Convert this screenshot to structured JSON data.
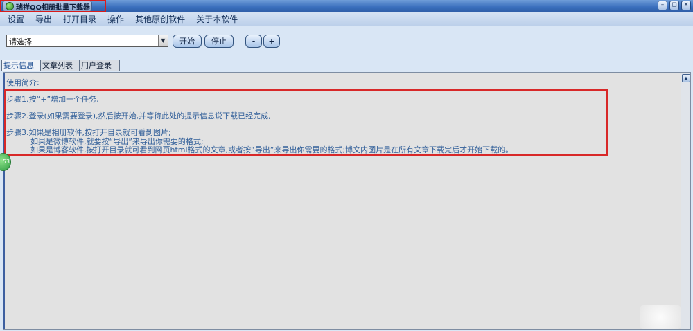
{
  "window": {
    "title": "瑞祥QQ相册批量下载器",
    "icons": [
      "app-icon",
      "minimize-icon",
      "restore-icon",
      "close-icon"
    ]
  },
  "menu": {
    "items": [
      "设置",
      "导出",
      "打开目录",
      "操作",
      "其他原创软件",
      "关于本软件"
    ]
  },
  "toolbar": {
    "select_value": "请选择",
    "start_label": "开始",
    "stop_label": "停止",
    "minus_label": "-",
    "plus_label": "+"
  },
  "tabs": [
    "提示信息",
    "文章列表",
    "用户登录"
  ],
  "content": {
    "heading": "使用简介:",
    "step1": "步骤1.按“+”增加一个任务,",
    "step2": "步骤2.登录(如果需要登录),然后按开始,并等待此处的提示信息说下载已经完成,",
    "step3": "步骤3.如果是相册软件,按打开目录就可看到图片;",
    "step3_b": "如果是微博软件,就要按“导出”来导出你需要的格式;",
    "step3_c": "如果是博客软件,按打开目录就可看到网页html格式的文章,或者按“导出”来导出你需要的格式;博文内图片是在所有文章下载完后才开始下载的。"
  },
  "overlay": {
    "badge_text": "53"
  }
}
